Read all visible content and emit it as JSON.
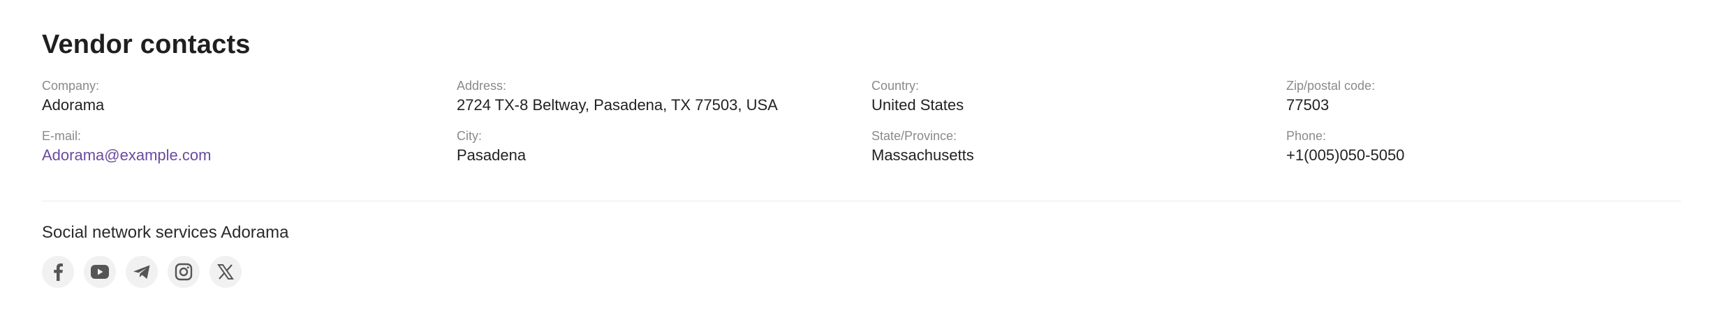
{
  "title": "Vendor contacts",
  "fields": {
    "company": {
      "label": "Company:",
      "value": "Adorama"
    },
    "address": {
      "label": "Address:",
      "value": "2724 TX-8 Beltway, Pasadena, TX 77503, USA"
    },
    "country": {
      "label": "Country:",
      "value": "United States"
    },
    "zip": {
      "label": "Zip/postal code:",
      "value": "77503"
    },
    "email": {
      "label": "E-mail:",
      "value": "Adorama@example.com"
    },
    "city": {
      "label": "City:",
      "value": "Pasadena"
    },
    "state": {
      "label": "State/Province:",
      "value": "Massachusetts"
    },
    "phone": {
      "label": "Phone:",
      "value": "+1(005)050-5050"
    }
  },
  "social": {
    "title": "Social network services Adorama",
    "icons": [
      "facebook-icon",
      "youtube-icon",
      "telegram-icon",
      "instagram-icon",
      "x-icon"
    ]
  },
  "colors": {
    "link": "#6a4aa0",
    "label": "#8a8a8a",
    "icon": "#555555",
    "icon_bg": "#f1f1f1"
  }
}
